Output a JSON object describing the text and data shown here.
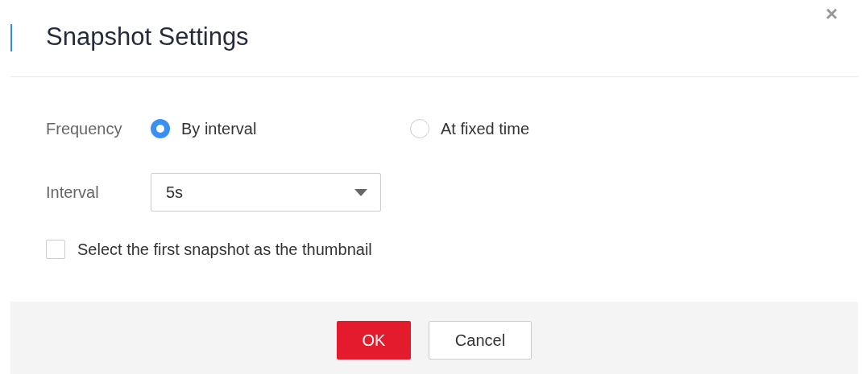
{
  "dialog": {
    "title": "Snapshot Settings",
    "close": "×"
  },
  "frequency": {
    "label": "Frequency",
    "options": [
      {
        "label": "By interval",
        "selected": true
      },
      {
        "label": "At fixed time",
        "selected": false
      }
    ]
  },
  "interval": {
    "label": "Interval",
    "value": "5s"
  },
  "thumbnail_option": {
    "label": "Select the first snapshot as the thumbnail",
    "checked": false
  },
  "buttons": [
    {
      "label": "OK",
      "kind": "primary"
    },
    {
      "label": "Cancel",
      "kind": "secondary"
    }
  ]
}
